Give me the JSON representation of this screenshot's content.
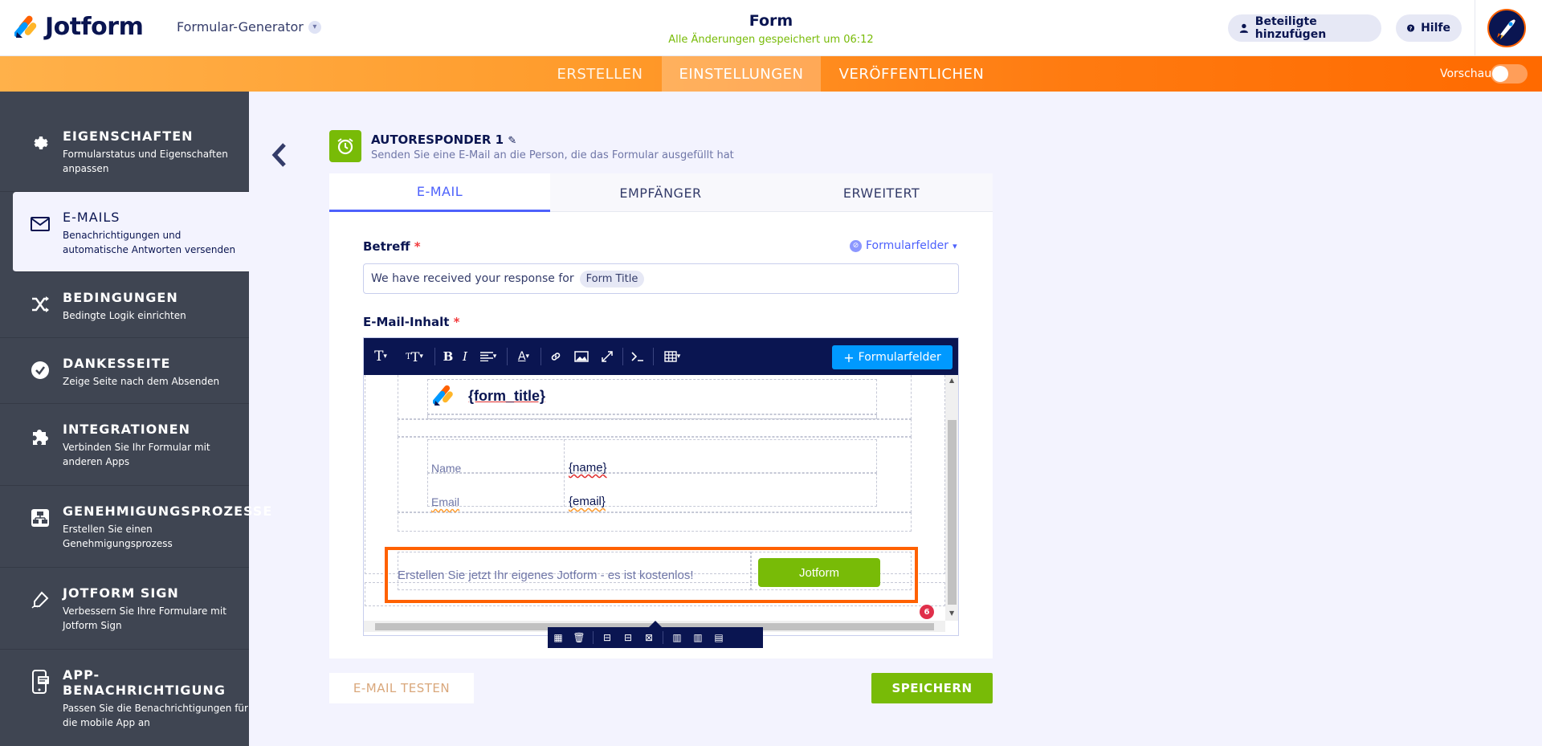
{
  "header": {
    "logo_text": "Jotform",
    "builder_label": "Formular-Generator",
    "form_name": "Form",
    "save_status": "Alle Änderungen gespeichert um 06:12",
    "add_participants": "Beteiligte hinzufügen",
    "help": "Hilfe"
  },
  "nav": {
    "create": "ERSTELLEN",
    "settings": "EINSTELLUNGEN",
    "publish": "VERÖFFENTLICHEN",
    "preview": "Vorschau",
    "preview_on": false
  },
  "sidebar": {
    "items": [
      {
        "title": "EIGENSCHAFTEN",
        "desc": "Formularstatus und Eigenschaften anpassen",
        "icon": "gear-icon"
      },
      {
        "title": "E-MAILS",
        "desc": "Benachrichtigungen und automatische Antworten versenden",
        "icon": "envelope-icon"
      },
      {
        "title": "BEDINGUNGEN",
        "desc": "Bedingte Logik einrichten",
        "icon": "shuffle-icon"
      },
      {
        "title": "DANKESSEITE",
        "desc": "Zeige Seite nach dem Absenden",
        "icon": "check-circle-icon"
      },
      {
        "title": "INTEGRATIONEN",
        "desc": "Verbinden Sie Ihr Formular mit anderen Apps",
        "icon": "puzzle-icon"
      },
      {
        "title": "GENEHMIGUNGSPROZESSE",
        "desc": "Erstellen Sie einen Genehmigungsprozess",
        "icon": "flow-icon"
      },
      {
        "title": "JOTFORM SIGN",
        "desc": "Verbessern Sie Ihre Formulare mit Jotform Sign",
        "icon": "pen-icon"
      },
      {
        "title": "APP-BENACHRICHTIGUNG",
        "desc": "Passen Sie die Benachrichtigungen für die mobile App an",
        "icon": "phone-icon"
      }
    ]
  },
  "autoresponder": {
    "title": "AUTORESPONDER 1",
    "subtitle": "Senden Sie eine E-Mail an die Person, die das Formular ausgefüllt hat"
  },
  "tabs": {
    "email": "E-MAIL",
    "recipients": "EMPFÄNGER",
    "advanced": "ERWEITERT"
  },
  "subject": {
    "label": "Betreff",
    "required_mark": "*",
    "form_fields_link": "Formularfelder",
    "text": "We have received your response for",
    "tag": "Form Title"
  },
  "content": {
    "label": "E-Mail-Inhalt",
    "required_mark": "*",
    "toolbar_form_fields": "Formularfelder",
    "form_title_placeholder": "{form_title}",
    "rows": [
      {
        "label": "Name",
        "value": "{name}"
      },
      {
        "label": "Email",
        "value": "{email}"
      }
    ],
    "footer_text": "Erstellen Sie jetzt Ihr eigenes Jotform - es ist kostenlos!",
    "footer_button": "Jotform",
    "badge_count": "6"
  },
  "actions": {
    "test_email": "E-MAIL TESTEN",
    "save": "SPEICHERN"
  },
  "colors": {
    "brand_orange": "#ff6100",
    "brand_green": "#78bb07",
    "navy": "#0a1551",
    "accent_blue": "#4d61fc"
  }
}
